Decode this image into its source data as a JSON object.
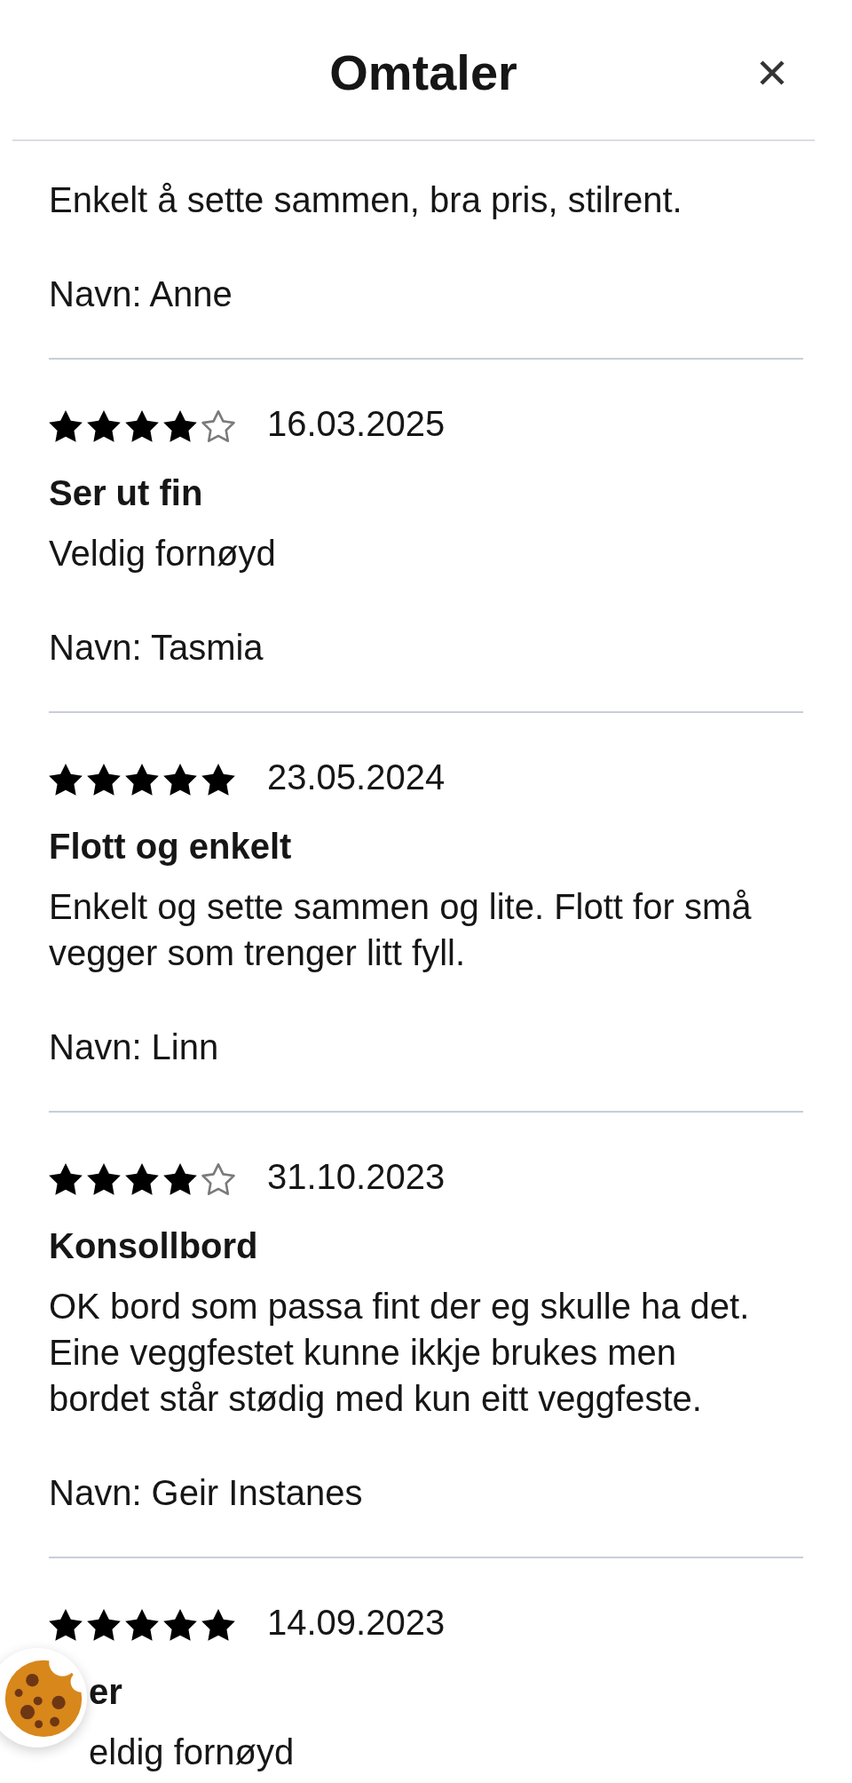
{
  "header": {
    "title": "Omtaler"
  },
  "reviews": [
    {
      "text": "Enkelt å sette sammen, bra pris, stilrent.",
      "name": "Navn: Anne",
      "partly_covered": false
    },
    {
      "stars": 4,
      "date": "16.03.2025",
      "title": "Ser ut fin",
      "text": "Veldig fornøyd",
      "name": "Navn: Tasmia",
      "partly_covered": false
    },
    {
      "stars": 5,
      "date": "23.05.2024",
      "title": "Flott og enkelt",
      "text": "Enkelt og sette sammen og lite. Flott for små vegger som trenger litt fyll.",
      "name": "Navn: Linn",
      "partly_covered": false
    },
    {
      "stars": 4,
      "date": "31.10.2023",
      "title": "Konsollbord",
      "text": "OK bord som passa fint der eg skulle ha det. Eine veggfestet kunne ikkje brukes men bordet står stødig med kun eitt veggfeste.",
      "name": "Navn: Geir Instanes",
      "partly_covered": false
    },
    {
      "stars": 5,
      "date": "14.09.2023",
      "title": "er",
      "text": "eldig fornøyd",
      "partly_covered": true
    }
  ]
}
